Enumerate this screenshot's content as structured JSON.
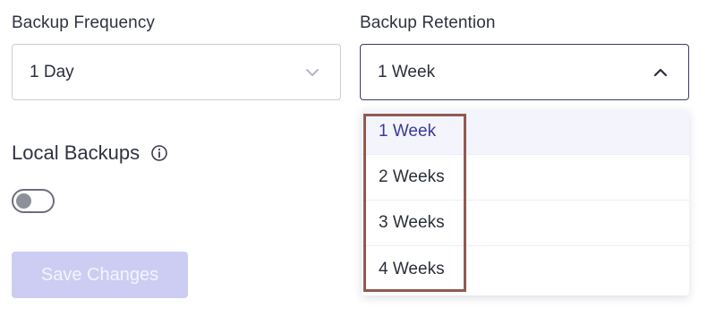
{
  "backup_frequency": {
    "label": "Backup Frequency",
    "value": "1 Day",
    "icon": "chevron-down-icon"
  },
  "backup_retention": {
    "label": "Backup Retention",
    "value": "1 Week",
    "icon": "chevron-up-icon",
    "options": [
      "1 Week",
      "2 Weeks",
      "3 Weeks",
      "4 Weeks"
    ],
    "selected_index": 0
  },
  "local_backups": {
    "title": "Local Backups",
    "info_icon": "info-icon",
    "toggle_on": false
  },
  "actions": {
    "save_label": "Save Changes",
    "save_enabled": false
  },
  "colors": {
    "accent": "#39397a",
    "save_button_disabled": "#cdcdf3",
    "selected_option_text": "#3a3a9a",
    "annotation_box": "#8e5b52"
  }
}
